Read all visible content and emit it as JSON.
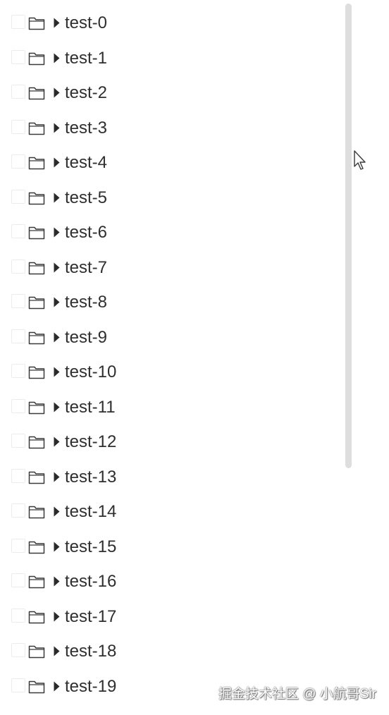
{
  "tree": {
    "nodes": [
      {
        "label": "test-0"
      },
      {
        "label": "test-1"
      },
      {
        "label": "test-2"
      },
      {
        "label": "test-3"
      },
      {
        "label": "test-4"
      },
      {
        "label": "test-5"
      },
      {
        "label": "test-6"
      },
      {
        "label": "test-7"
      },
      {
        "label": "test-8"
      },
      {
        "label": "test-9"
      },
      {
        "label": "test-10"
      },
      {
        "label": "test-11"
      },
      {
        "label": "test-12"
      },
      {
        "label": "test-13"
      },
      {
        "label": "test-14"
      },
      {
        "label": "test-15"
      },
      {
        "label": "test-16"
      },
      {
        "label": "test-17"
      },
      {
        "label": "test-18"
      },
      {
        "label": "test-19"
      }
    ],
    "node_icon": "folder-icon",
    "expander_icon": "caret-right-icon",
    "checked": false
  },
  "watermark": {
    "text": "掘金技术社区 @ 小航哥Sir"
  },
  "colors": {
    "text": "#2f2f2f",
    "scrollbar": "#dedede",
    "checkbox_border": "#ececec"
  }
}
